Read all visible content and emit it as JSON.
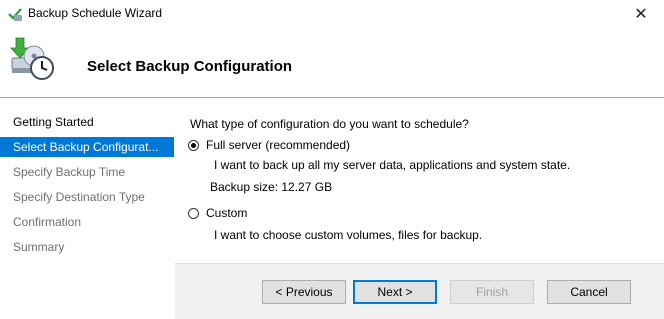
{
  "window": {
    "title": "Backup Schedule Wizard",
    "close_glyph": "✕"
  },
  "header": {
    "title": "Select Backup Configuration"
  },
  "nav": {
    "items": [
      {
        "label": "Getting Started"
      },
      {
        "label": "Select Backup Configurat..."
      },
      {
        "label": "Specify Backup Time"
      },
      {
        "label": "Specify Destination Type"
      },
      {
        "label": "Confirmation"
      },
      {
        "label": "Summary"
      }
    ],
    "active_index": 1
  },
  "content": {
    "question": "What type of configuration do you want to schedule?",
    "options": [
      {
        "label": "Full server (recommended)",
        "description": "I want to back up all my server data, applications and system state.",
        "extra": "Backup size: 12.27 GB",
        "checked": true
      },
      {
        "label": "Custom",
        "description": "I want to choose custom volumes, files for backup.",
        "checked": false
      }
    ]
  },
  "buttons": {
    "previous": "< Previous",
    "next": "Next >",
    "finish": "Finish",
    "cancel": "Cancel"
  },
  "colors": {
    "accent": "#0078d7"
  }
}
